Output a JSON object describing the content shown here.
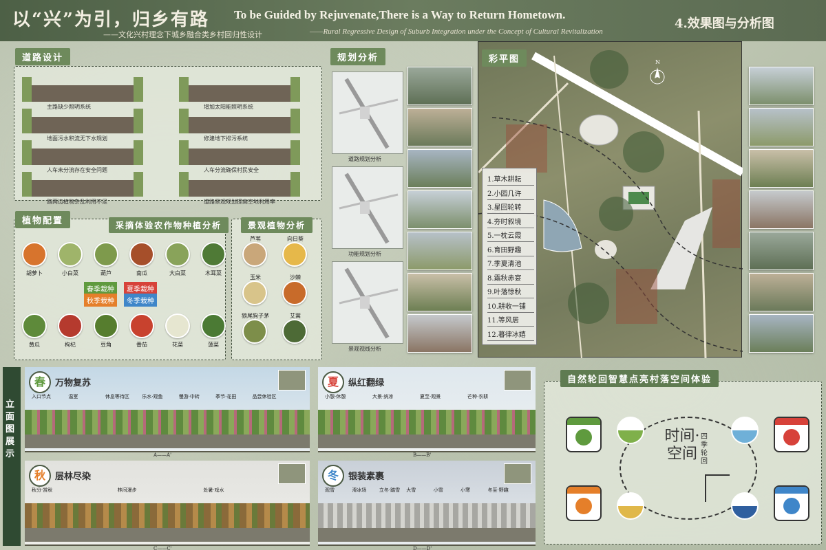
{
  "header": {
    "title_cn": "以“兴”为引，归乡有路",
    "subtitle_cn": "——文化兴村理念下城乡融合类乡村回归性设计",
    "title_en": "To be Guided by Rejuvenate,There is a Way to Return Hometown.",
    "subtitle_en": "——Rural Regressive Design of Suburb Integration under the Concept of Cultural Revitalization",
    "page_label": "4.效果图与分析图"
  },
  "road_design": {
    "tag": "道路设计",
    "items": [
      "主路缺少照明系统",
      "增加太阳能照明系统",
      "地面污水积流无下水规划",
      "修建地下排污系统",
      "人车未分流存在安全问题",
      "人车分流确保村民安全",
      "路两边植物杂乱利用不足",
      "道路景观规划提高空地利用率"
    ]
  },
  "plant_config": {
    "tag": "植物配置",
    "crop_title": "采摘体验农作物种植分析",
    "crops_top": [
      "胡萝卜",
      "小白菜",
      "葫芦",
      "南瓜",
      "大白菜",
      "木耳菜"
    ],
    "crops_bottom": [
      "黄瓜",
      "枸杞",
      "豆角",
      "番茄",
      "花菜",
      "菠菜"
    ],
    "seasons": [
      "春季栽种",
      "夏季栽种",
      "秋季栽种",
      "冬季栽种"
    ],
    "landscape_title": "景观植物分析",
    "landscape": [
      "芦苇",
      "向日葵",
      "玉米",
      "沙棘",
      "狼尾狗子茅",
      "艾蒿"
    ]
  },
  "planning": {
    "tag": "规划分析",
    "captions": [
      "道路规划分析",
      "功能规划分析",
      "景观视线分析"
    ]
  },
  "master_plan": {
    "tag": "彩平图",
    "legend": [
      "1.草木耕耘",
      "2.小园几许",
      "3.星回轮转",
      "4.夯时叙境",
      "5.一枕云霞",
      "6.育田野趣",
      "7.季夏清池",
      "8.霜秋赤宴",
      "9.叶落惊秋",
      "10.耕收一铺",
      "11.等风居",
      "12.暮律冰嬉"
    ]
  },
  "elevation": {
    "tag": "立面图展示",
    "spring": {
      "badge": "春",
      "title": "万物复苏",
      "labels": [
        "入口节点",
        "温室",
        "休息等待区",
        "乐水·观鱼",
        "慢游·中转",
        "季节·花田",
        "品尝休验区"
      ],
      "section": "A——A'"
    },
    "summer": {
      "badge": "夏",
      "title": "纵红翻绿",
      "labels": [
        "小憩·休憩",
        "大景·纳凉",
        "夏至·观景",
        "芒种·农耕"
      ],
      "section": "B——B'"
    },
    "autumn": {
      "badge": "秋",
      "title": "层林尽染",
      "labels": [
        "秋分·赏秋",
        "林间漫步",
        "处暑·戏水"
      ],
      "section": "C——C'"
    },
    "winter": {
      "badge": "冬",
      "title": "银装素裹",
      "labels": [
        "观雪",
        "滑冰场",
        "立冬·踏雪",
        "大雪",
        "小雪",
        "小寒",
        "冬至·野趣"
      ],
      "section": "D——D'"
    }
  },
  "experience": {
    "tag": "自然轮回智慧点亮村落空间体验",
    "center_time": "时间·空间",
    "side_text": "四季轮回"
  },
  "compass": "N",
  "colors": {
    "accent": "#6e8a5c",
    "header": "#4d6046",
    "spring": "#5f9a3e",
    "summer": "#d7423a",
    "autumn": "#e57f2a",
    "winter": "#3f86c9"
  }
}
